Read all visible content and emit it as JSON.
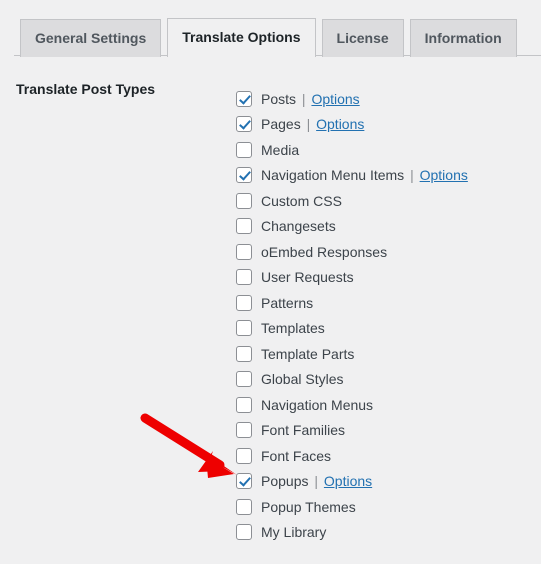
{
  "tabs": [
    {
      "label": "General Settings",
      "active": false
    },
    {
      "label": "Translate Options",
      "active": true
    },
    {
      "label": "License",
      "active": false
    },
    {
      "label": "Information",
      "active": false
    }
  ],
  "form": {
    "field_label": "Translate Post Types"
  },
  "post_types": [
    {
      "label": "Posts",
      "checked": true,
      "separator": "|",
      "link": "Options"
    },
    {
      "label": "Pages",
      "checked": true,
      "separator": "|",
      "link": "Options"
    },
    {
      "label": "Media",
      "checked": false,
      "separator": "",
      "link": ""
    },
    {
      "label": "Navigation Menu Items",
      "checked": true,
      "separator": "|",
      "link": "Options"
    },
    {
      "label": "Custom CSS",
      "checked": false,
      "separator": "",
      "link": ""
    },
    {
      "label": "Changesets",
      "checked": false,
      "separator": "",
      "link": ""
    },
    {
      "label": "oEmbed Responses",
      "checked": false,
      "separator": "",
      "link": ""
    },
    {
      "label": "User Requests",
      "checked": false,
      "separator": "",
      "link": ""
    },
    {
      "label": "Patterns",
      "checked": false,
      "separator": "",
      "link": ""
    },
    {
      "label": "Templates",
      "checked": false,
      "separator": "",
      "link": ""
    },
    {
      "label": "Template Parts",
      "checked": false,
      "separator": "",
      "link": ""
    },
    {
      "label": "Global Styles",
      "checked": false,
      "separator": "",
      "link": ""
    },
    {
      "label": "Navigation Menus",
      "checked": false,
      "separator": "",
      "link": ""
    },
    {
      "label": "Font Families",
      "checked": false,
      "separator": "",
      "link": ""
    },
    {
      "label": "Font Faces",
      "checked": false,
      "separator": "",
      "link": ""
    },
    {
      "label": "Popups",
      "checked": true,
      "separator": "|",
      "link": "Options"
    },
    {
      "label": "Popup Themes",
      "checked": false,
      "separator": "",
      "link": ""
    },
    {
      "label": "My Library",
      "checked": false,
      "separator": "",
      "link": ""
    }
  ],
  "annotation": {
    "icon": "red-arrow-icon",
    "points_at": "Popups",
    "color": "#ee0000"
  },
  "colors": {
    "page_background": "#f0f0f1",
    "tab_inactive": "#dcdcde",
    "tab_active": "#f0f0f1",
    "border": "#c3c4c7",
    "link": "#2271b1",
    "checkmark": "#2271b1",
    "text": "#3c434a",
    "heading": "#1d2327"
  }
}
